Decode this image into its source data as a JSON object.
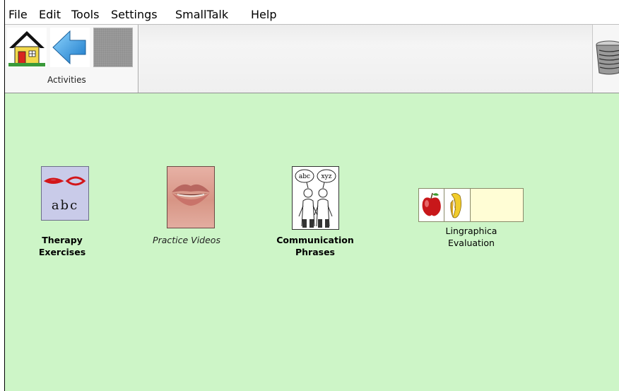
{
  "menu": [
    "File",
    "Edit",
    "Tools",
    "Settings",
    "SmallTalk",
    "Help"
  ],
  "toolbar": {
    "home_icon": "home-icon",
    "back_icon": "back-arrow-icon",
    "activities_label": "Activities",
    "trash_icon": "trash-can-icon"
  },
  "activities": [
    {
      "line1": "Therapy",
      "line2": "Exercises",
      "icon": "abc-lips-icon",
      "image_text": "abc"
    },
    {
      "label": "Practice Videos",
      "icon": "mouth-video-icon"
    },
    {
      "line1": "Communication",
      "line2": "Phrases",
      "icon": "speech-bubbles-people-icon",
      "bubble1": "abc",
      "bubble2": "xyz"
    },
    {
      "line1": "Lingraphica",
      "line2": "Evaluation",
      "icon": "apple-banana-icon"
    }
  ],
  "colors": {
    "workarea": "#cdf5c7",
    "toolbar": "#f6f6f6",
    "therapy_bg": "#c9cbe9"
  }
}
